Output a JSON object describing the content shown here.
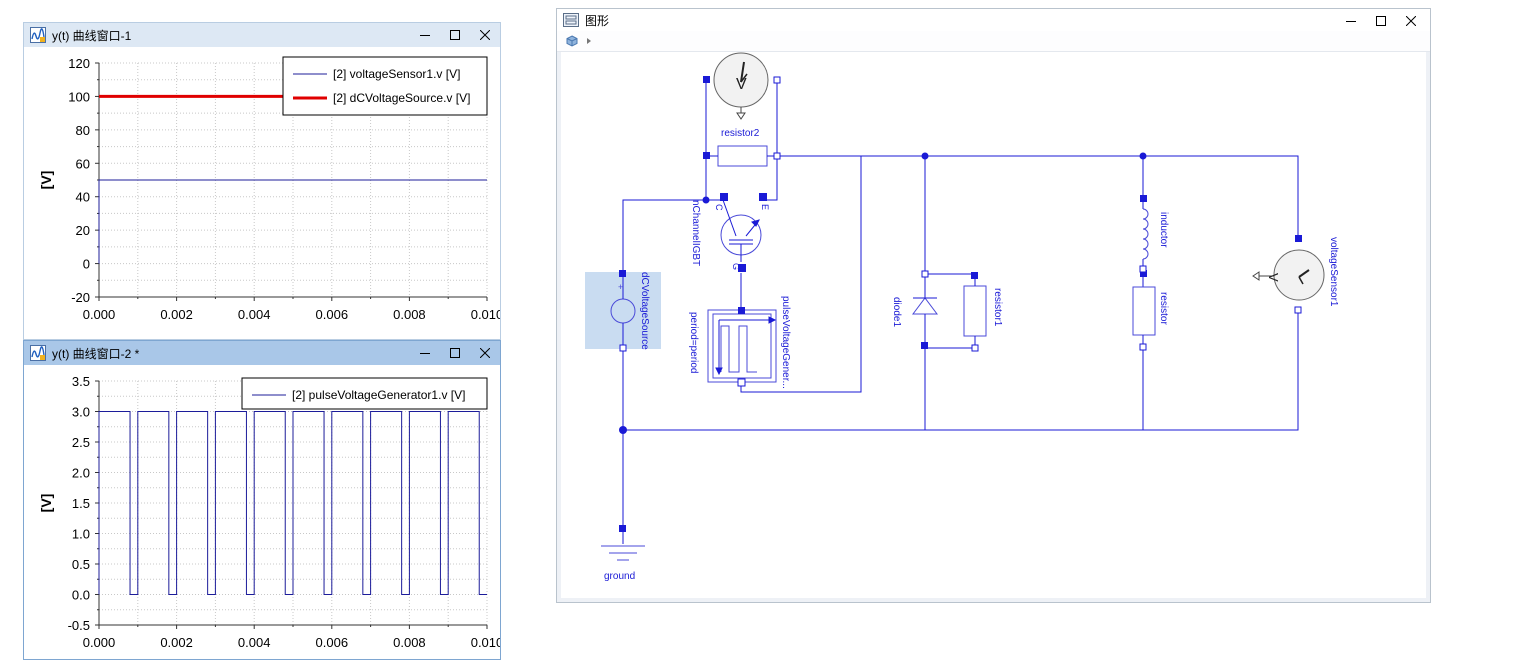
{
  "plot1": {
    "title": "y(t) 曲线窗口-1",
    "ylabel": "[V]",
    "yticks": [
      "120",
      "100",
      "80",
      "60",
      "40",
      "20",
      "0",
      "-20"
    ],
    "xticks": [
      "0.000",
      "0.002",
      "0.004",
      "0.006",
      "0.008",
      "0.010"
    ],
    "legend": [
      "[2] voltageSensor1.v [V]",
      "[2] dCVoltageSource.v [V]"
    ],
    "colors": {
      "series1": "#1c1c9a",
      "series2": "#e00000"
    }
  },
  "plot2": {
    "title": "y(t) 曲线窗口-2 *",
    "ylabel": "[V]",
    "yticks": [
      "3.5",
      "3.0",
      "2.5",
      "2.0",
      "1.5",
      "1.0",
      "0.5",
      "0.0",
      "-0.5"
    ],
    "xticks": [
      "0.000",
      "0.002",
      "0.004",
      "0.006",
      "0.008",
      "0.010"
    ],
    "legend": [
      "[2] pulseVoltageGenerator1.v [V]"
    ],
    "colors": {
      "series1": "#1c1c9a"
    }
  },
  "chart_data": [
    {
      "type": "line",
      "xlim": [
        0,
        0.01
      ],
      "ylim": [
        -20,
        120
      ],
      "grid": true,
      "legend_position": "top-right",
      "series": [
        {
          "name": "[2] voltageSensor1.v [V]",
          "x": [
            0,
            0,
            0.01
          ],
          "y": [
            0,
            50,
            50
          ]
        },
        {
          "name": "[2] dCVoltageSource.v [V]",
          "x": [
            0,
            0.01
          ],
          "y": [
            100,
            100
          ]
        }
      ]
    },
    {
      "type": "line",
      "xlim": [
        0,
        0.01
      ],
      "ylim": [
        -0.5,
        3.5
      ],
      "grid": true,
      "legend_position": "top-right",
      "series": [
        {
          "name": "[2] pulseVoltageGenerator1.v [V]",
          "period": 0.001,
          "high_duration": 0.0008,
          "low": 0,
          "high": 3,
          "x_range": [
            0,
            0.01
          ]
        }
      ]
    }
  ],
  "diagram": {
    "title": "图形",
    "labels": {
      "resistor2": "resistor2",
      "nChannelIGBT": "nChannelIGBT",
      "C": "C",
      "E": "E",
      "G": "G",
      "dCVoltageSource": "dCVoltageSource",
      "pulseVoltageGenerator": "pulseVoltageGener...",
      "period": "period=period",
      "diode1": "diode1",
      "resistor1": "resistor1",
      "inductor": "inductor",
      "resistor": "resistor",
      "voltageSensor1": "voltageSensor1",
      "ground": "ground",
      "V": "V"
    },
    "colors": {
      "wire": "#1a1ad6"
    }
  }
}
